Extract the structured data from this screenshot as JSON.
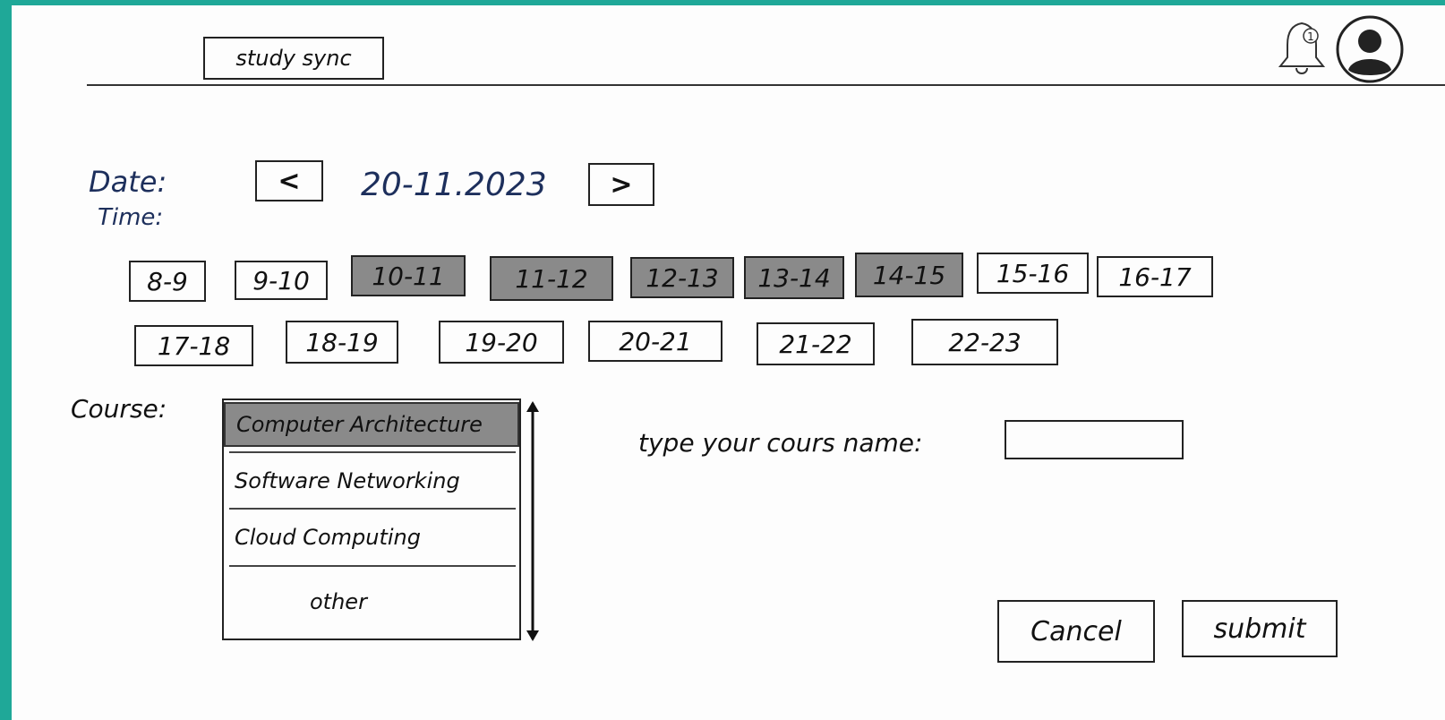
{
  "header": {
    "brand": "study sync",
    "notification_count": "1",
    "icons": [
      "bell-icon",
      "avatar-icon"
    ]
  },
  "form": {
    "date_label": "Date:",
    "time_label": "Time:",
    "date_value": "20-11.2023",
    "prev_label": "<",
    "next_label": ">",
    "time_slots": [
      {
        "label": "8-9",
        "selected": false
      },
      {
        "label": "9-10",
        "selected": false
      },
      {
        "label": "10-11",
        "selected": true
      },
      {
        "label": "11-12",
        "selected": true
      },
      {
        "label": "12-13",
        "selected": true
      },
      {
        "label": "13-14",
        "selected": true
      },
      {
        "label": "14-15",
        "selected": true
      },
      {
        "label": "15-16",
        "selected": false
      },
      {
        "label": "16-17",
        "selected": false
      },
      {
        "label": "17-18",
        "selected": false
      },
      {
        "label": "18-19",
        "selected": false
      },
      {
        "label": "19-20",
        "selected": false
      },
      {
        "label": "20-21",
        "selected": false
      },
      {
        "label": "21-22",
        "selected": false
      },
      {
        "label": "22-23",
        "selected": false
      }
    ],
    "course_label": "Course:",
    "courses": [
      {
        "label": "Computer Architecture",
        "selected": true
      },
      {
        "label": "Software Networking",
        "selected": false
      },
      {
        "label": "Cloud Computing",
        "selected": false
      },
      {
        "label": "other",
        "selected": false
      }
    ],
    "type_course_label": "type your cours name:",
    "type_course_value": "",
    "cancel_label": "Cancel",
    "submit_label": "submit"
  },
  "colors": {
    "frame": "#1fa898",
    "selected_fill": "#8a8a8a",
    "ink": "#111111",
    "date_ink": "#1d2f5c"
  }
}
